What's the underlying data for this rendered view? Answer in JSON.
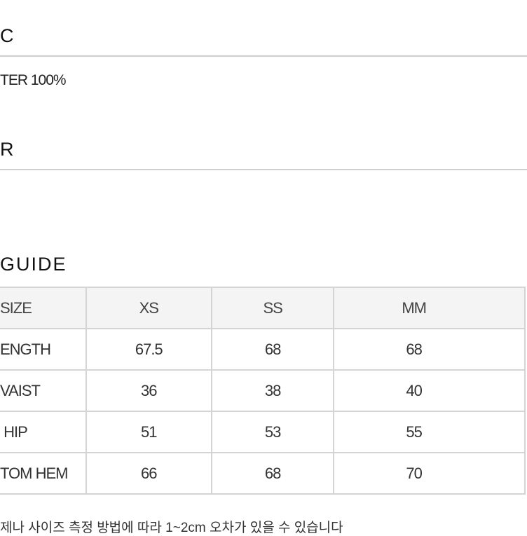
{
  "sections": [
    {
      "title": "C",
      "content": "TER 100%"
    },
    {
      "title": "R",
      "content": ""
    }
  ],
  "size_guide": {
    "title": "GUIDE",
    "columns": [
      "SIZE",
      "XS",
      "SS",
      "MM"
    ],
    "rows": [
      [
        "ENGTH",
        "67.5",
        "68",
        "68"
      ],
      [
        "VAIST",
        "36",
        "38",
        "40"
      ],
      [
        " HIP",
        "51",
        "53",
        "55"
      ],
      [
        "TOM HEM",
        "66",
        "68",
        "70"
      ]
    ],
    "note": "제나 사이즈 측정 방법에 따라 1~2cm 오차가 있을 수 있습니다"
  }
}
